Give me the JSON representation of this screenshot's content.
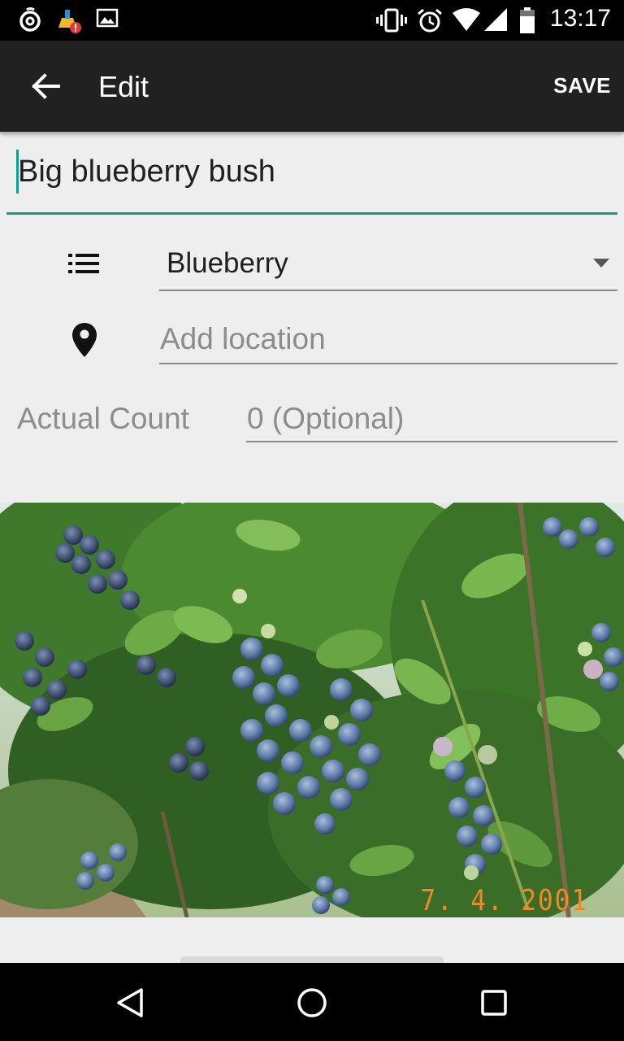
{
  "status_bar": {
    "time": "13:17",
    "icons": [
      "netease-music-icon",
      "cleaner-alert-icon",
      "gallery-icon",
      "vibrate-icon",
      "alarm-icon",
      "wifi-icon",
      "signal-icon",
      "battery-icon"
    ]
  },
  "app_bar": {
    "title": "Edit",
    "save_label": "SAVE"
  },
  "form": {
    "name_value": "Big blueberry bush",
    "category_value": "Blueberry",
    "location_placeholder": "Add location",
    "count_label": "Actual Count",
    "count_placeholder": "0 (Optional)"
  },
  "photo": {
    "date_stamp": "7. 4. 2001"
  },
  "colors": {
    "accent": "#159a8c",
    "app_bar": "#212121",
    "background": "#eeeeee"
  }
}
